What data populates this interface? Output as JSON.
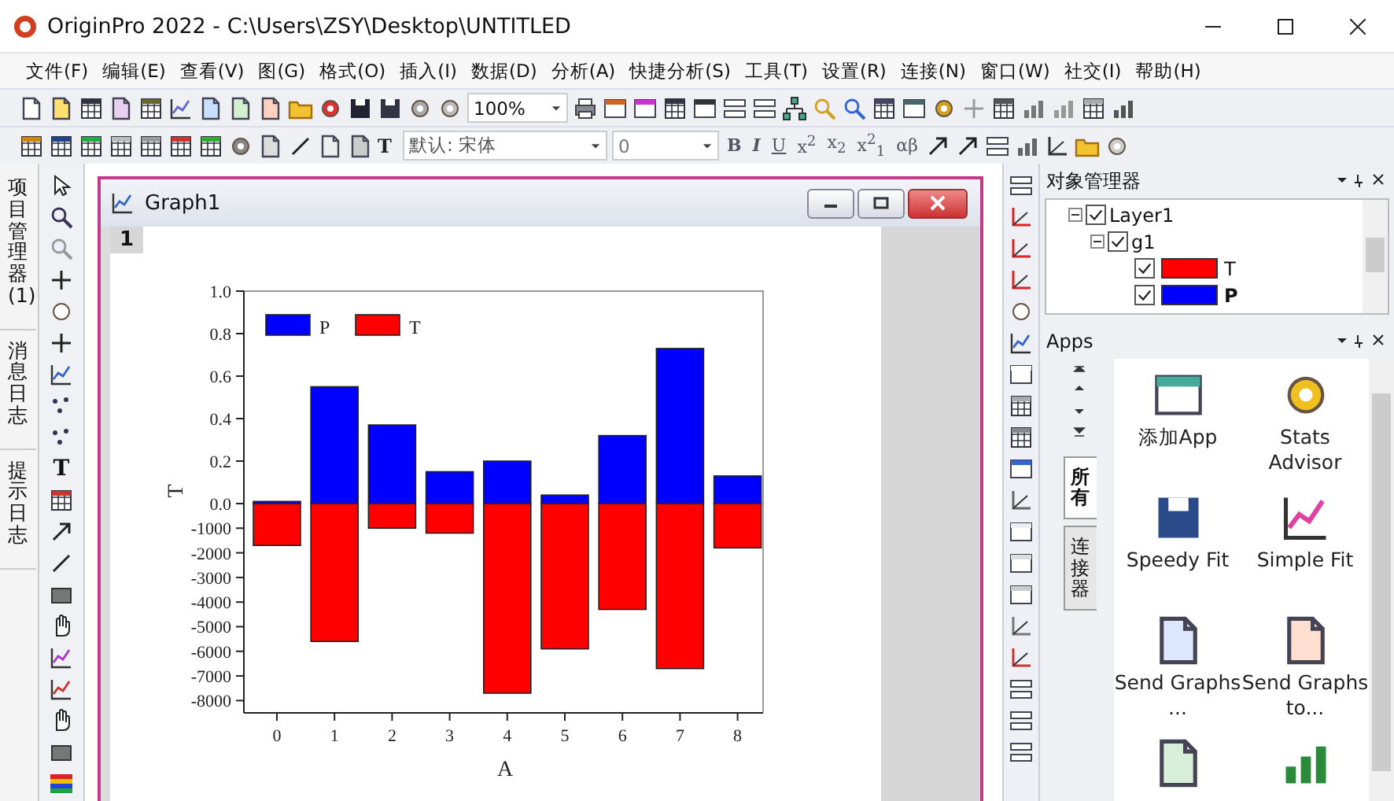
{
  "window": {
    "title": "OriginPro 2022 - C:\\Users\\ZSY\\Desktop\\UNTITLED"
  },
  "menu": [
    "文件(F)",
    "编辑(E)",
    "查看(V)",
    "图(G)",
    "格式(O)",
    "插入(I)",
    "数据(D)",
    "分析(A)",
    "快捷分析(S)",
    "工具(T)",
    "设置(R)",
    "连接(N)",
    "窗口(W)",
    "社交(I)",
    "帮助(H)"
  ],
  "toolbar": {
    "zoom": "100%",
    "font_glyph": "T",
    "font": "默认: 宋体",
    "font_size": "0",
    "format_buttons": [
      "B",
      "I",
      "U",
      "x$^{2}$",
      "x$_{2}$",
      "x$^{2}$$_{1}$",
      "αβ"
    ]
  },
  "left_dock_tabs": [
    {
      "label": "项目管理器 (1)"
    },
    {
      "label": "消息日志"
    },
    {
      "label": "提示日志"
    }
  ],
  "tools": {
    "text_tool": "T"
  },
  "graph_window": {
    "title": "Graph1",
    "layer": "1",
    "upper_panel": {
      "chart_data": {
        "type": "bar",
        "ylabel": "T",
        "ylim": [
          0,
          1.0
        ],
        "categories": [
          null,
          null,
          null,
          null,
          null,
          null,
          null,
          null,
          null
        ],
        "series": [
          {
            "name": "P",
            "color": "#0000ff",
            "values": [
              0.01,
              0.55,
              0.37,
              0.15,
              0.2,
              0.04,
              0.32,
              0.73,
              0.13
            ]
          }
        ],
        "yticks": [
          {
            "value": 1.0,
            "label": "1.0"
          },
          {
            "value": 0.8,
            "label": "0.8"
          },
          {
            "value": 0.6,
            "label": "0.6"
          },
          {
            "value": 0.4,
            "label": "0.4"
          },
          {
            "value": 0.2,
            "label": "0.2"
          },
          {
            "value": 0,
            "label": "0.0"
          }
        ]
      }
    },
    "lower_panel": {
      "chart_data": {
        "type": "bar",
        "xlabel": "A",
        "ylim": [
          -8500,
          0
        ],
        "categories": [
          "0",
          "1",
          "2",
          "3",
          "4",
          "5",
          "6",
          "7",
          "8"
        ],
        "series": [
          {
            "name": "T",
            "color": "#ff0000",
            "values": [
              -1700,
              -5600,
              -1000,
              -1200,
              -7700,
              -5900,
              -4300,
              -6700,
              -1800
            ]
          }
        ],
        "yticks": [
          -1000,
          -2000,
          -3000,
          -4000,
          -5000,
          -6000,
          -7000,
          -8000
        ]
      }
    }
  },
  "object_manager": {
    "title": "对象管理器",
    "tree": [
      {
        "label": "Layer1",
        "checked": true,
        "expanded": true,
        "children": [
          {
            "label": "g1",
            "checked": true,
            "expanded": true,
            "children": [
              {
                "label": "T",
                "checked": true,
                "color": "#ff0000",
                "selected": false
              },
              {
                "label": "P",
                "checked": true,
                "color": "#0000ff",
                "selected": true
              }
            ]
          }
        ]
      }
    ]
  },
  "apps": {
    "title": "Apps",
    "tabs": [
      {
        "label": "所有",
        "selected": true
      },
      {
        "label": "连接器",
        "selected": false
      }
    ],
    "items": [
      {
        "label": "添加App"
      },
      {
        "label": "Stats Advisor"
      },
      {
        "label": "Speedy Fit"
      },
      {
        "label": "Simple Fit"
      },
      {
        "label": "Send Graphs ..."
      },
      {
        "label": "Send Graphs to..."
      }
    ]
  }
}
